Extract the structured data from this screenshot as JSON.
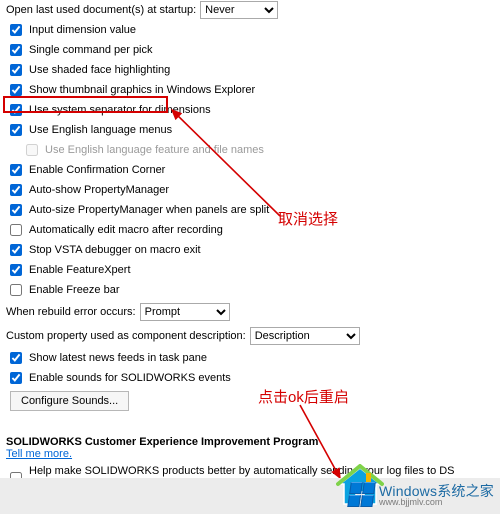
{
  "top": {
    "open_last_label": "Open last used document(s) at startup:",
    "open_last_value": "Never"
  },
  "options": {
    "input_dimension": "Input dimension value",
    "single_command": "Single command per pick",
    "shaded_face": "Use shaded face highlighting",
    "thumbnail": "Show thumbnail graphics in Windows Explorer",
    "sys_sep": "Use system separator for dimensions",
    "english_menus": "Use English language menus",
    "english_files": "Use English language feature and file names",
    "confirm_corner": "Enable Confirmation Corner",
    "auto_pm": "Auto-show PropertyManager",
    "autosize_pm": "Auto-size PropertyManager when panels are split",
    "auto_macro": "Automatically edit macro after recording",
    "stop_vsta": "Stop VSTA debugger on macro exit",
    "featurexpert": "Enable FeatureXpert",
    "freeze_bar": "Enable Freeze bar"
  },
  "rebuild": {
    "label": "When rebuild error occurs:",
    "value": "Prompt"
  },
  "custom_prop": {
    "label": "Custom property used as component description:",
    "value": "Description"
  },
  "lower": {
    "news": "Show latest news feeds in task pane",
    "sounds": "Enable sounds for SOLIDWORKS events",
    "config_btn": "Configure Sounds..."
  },
  "ceip": {
    "title": "SOLIDWORKS Customer Experience Improvement Program",
    "tell_more": "Tell me more.",
    "help_text": "Help make SOLIDWORKS products better by automatically sending your log files to DS SolidWorks Corporation"
  },
  "annotations": {
    "deselect": "取消选择",
    "ok_restart": "点击ok后重启"
  },
  "watermark": {
    "brand": "Windows系统之家",
    "url": "www.bjjmlv.com"
  }
}
